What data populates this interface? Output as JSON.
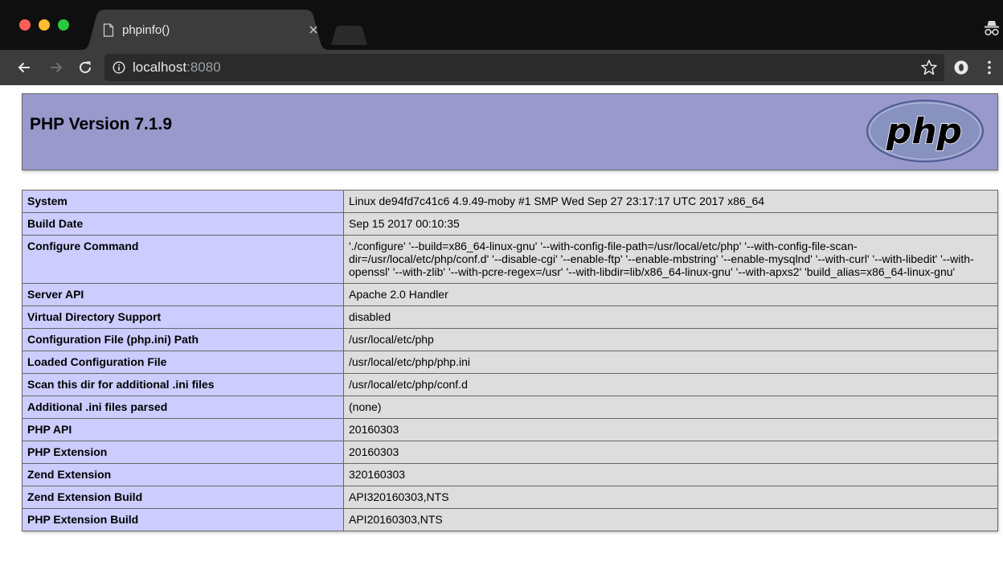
{
  "browser": {
    "tab": {
      "title": "phpinfo()"
    },
    "address": {
      "host": "localhost",
      "port": ":8080"
    }
  },
  "php": {
    "version_title": "PHP Version 7.1.9",
    "logo_text": "php",
    "rows": [
      {
        "key": "System",
        "value": "Linux de94fd7c41c6 4.9.49-moby #1 SMP Wed Sep 27 23:17:17 UTC 2017 x86_64"
      },
      {
        "key": "Build Date",
        "value": "Sep 15 2017 00:10:35"
      },
      {
        "key": "Configure Command",
        "value": "'./configure' '--build=x86_64-linux-gnu' '--with-config-file-path=/usr/local/etc/php' '--with-config-file-scan-dir=/usr/local/etc/php/conf.d' '--disable-cgi' '--enable-ftp' '--enable-mbstring' '--enable-mysqlnd' '--with-curl' '--with-libedit' '--with-openssl' '--with-zlib' '--with-pcre-regex=/usr' '--with-libdir=lib/x86_64-linux-gnu' '--with-apxs2' 'build_alias=x86_64-linux-gnu'"
      },
      {
        "key": "Server API",
        "value": "Apache 2.0 Handler"
      },
      {
        "key": "Virtual Directory Support",
        "value": "disabled"
      },
      {
        "key": "Configuration File (php.ini) Path",
        "value": "/usr/local/etc/php"
      },
      {
        "key": "Loaded Configuration File",
        "value": "/usr/local/etc/php/php.ini"
      },
      {
        "key": "Scan this dir for additional .ini files",
        "value": "/usr/local/etc/php/conf.d"
      },
      {
        "key": "Additional .ini files parsed",
        "value": "(none)"
      },
      {
        "key": "PHP API",
        "value": "20160303"
      },
      {
        "key": "PHP Extension",
        "value": "20160303"
      },
      {
        "key": "Zend Extension",
        "value": "320160303"
      },
      {
        "key": "Zend Extension Build",
        "value": "API320160303,NTS"
      },
      {
        "key": "PHP Extension Build",
        "value": "API20160303,NTS"
      }
    ]
  },
  "colors": {
    "header_bg": "#9999cc",
    "key_cell_bg": "#ccccff",
    "value_cell_bg": "#dddddd",
    "logo_fill": "#8892bf"
  }
}
